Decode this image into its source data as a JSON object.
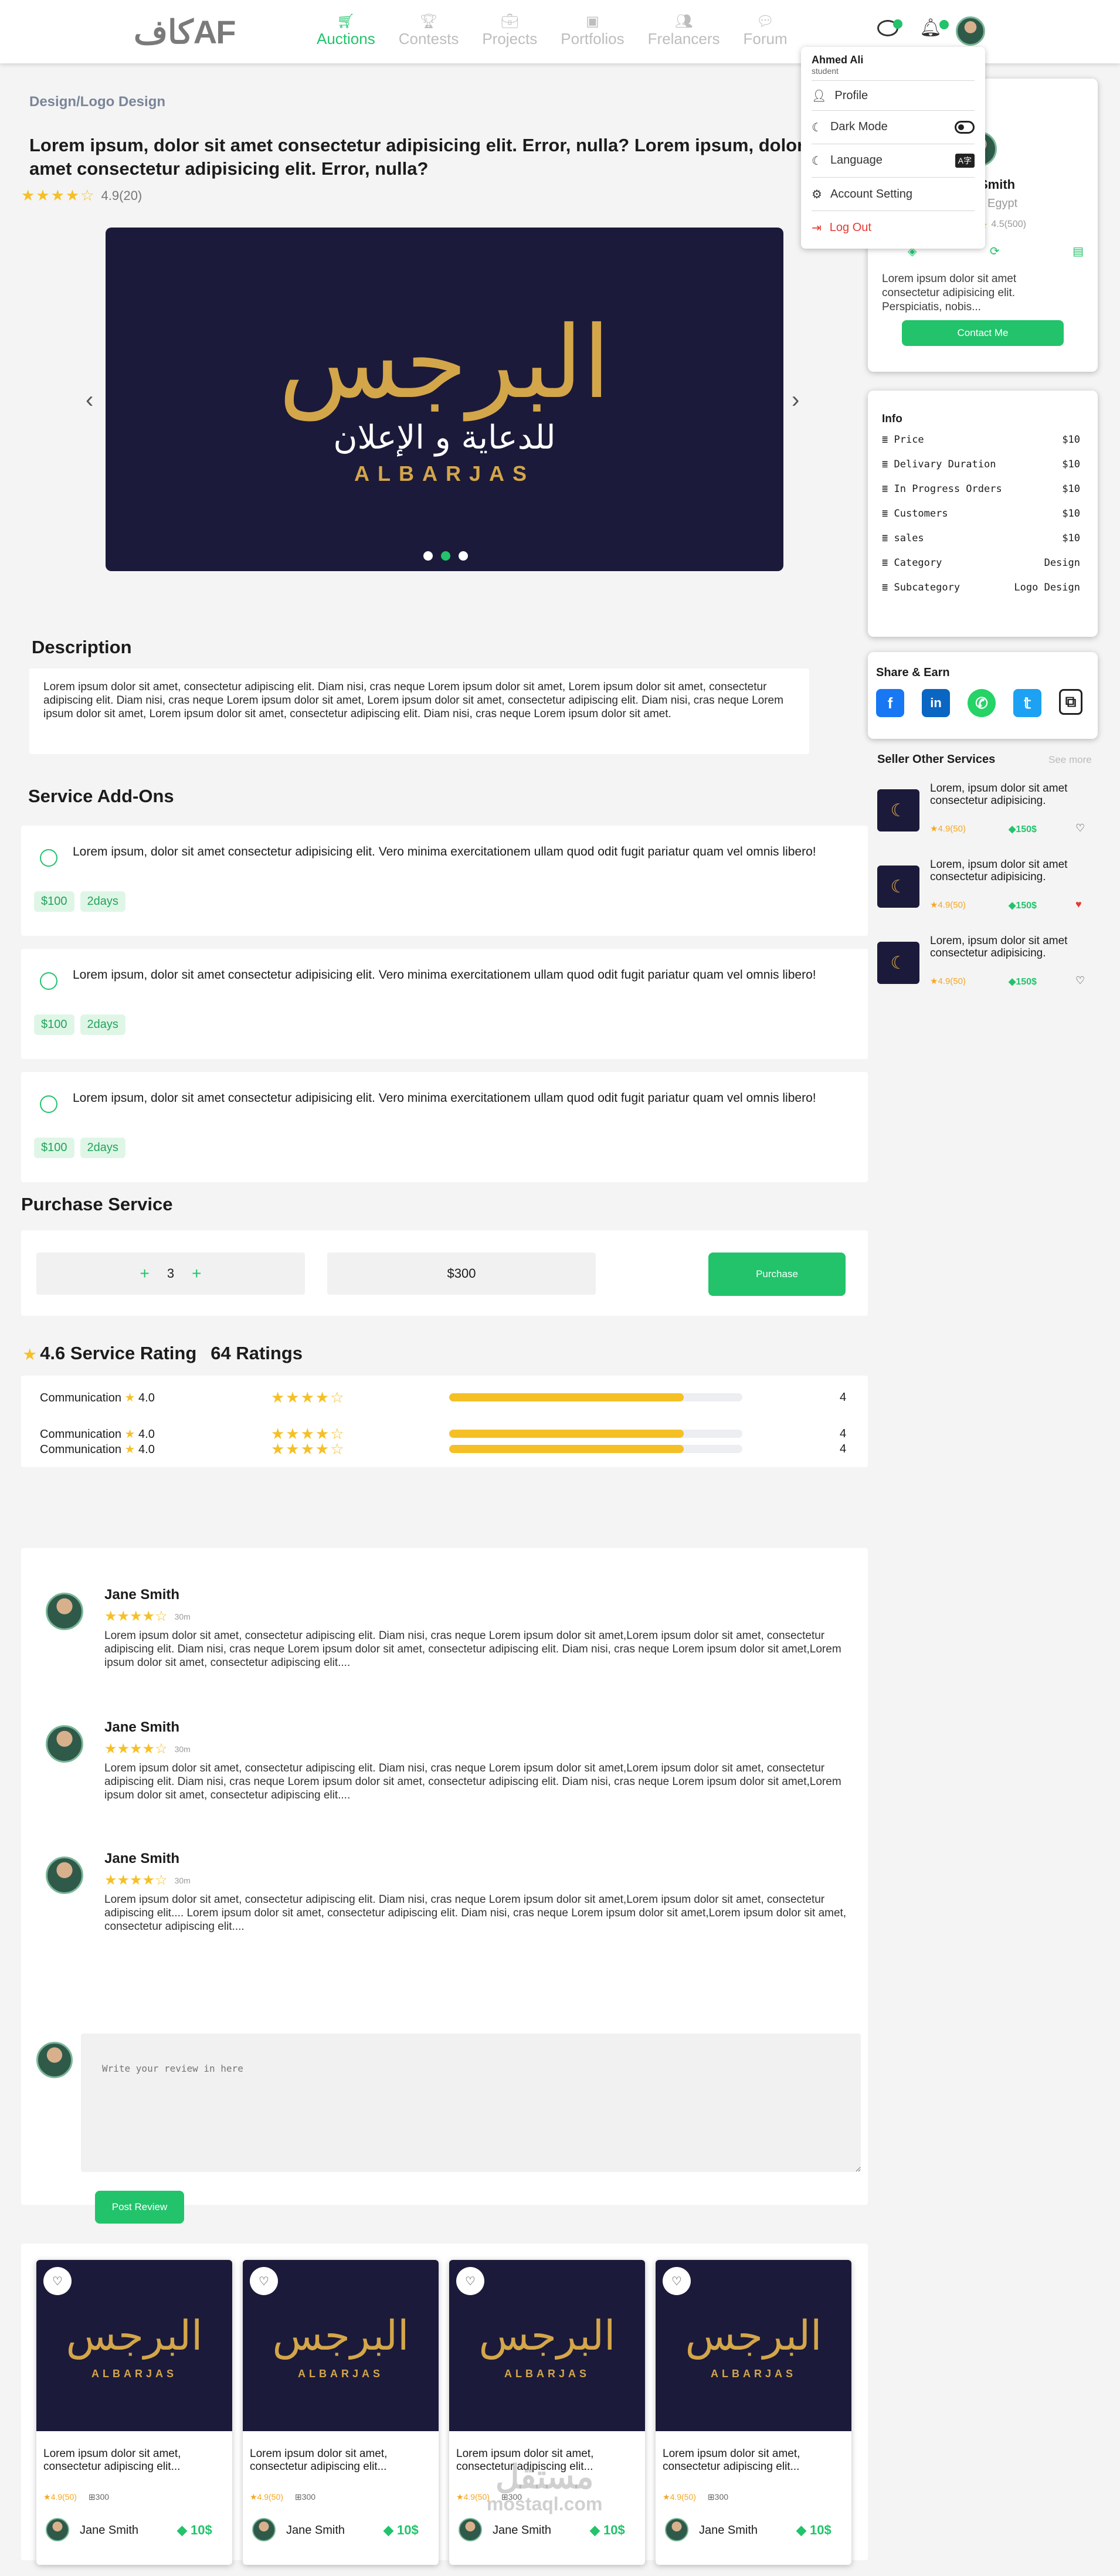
{
  "header": {
    "logo_text": "كافAF",
    "nav": [
      {
        "label": "Auctions",
        "active": true
      },
      {
        "label": "Contests",
        "active": false
      },
      {
        "label": "Projects",
        "active": false
      },
      {
        "label": "Portfolios",
        "active": false
      },
      {
        "label": "Frelancers",
        "active": false
      },
      {
        "label": "Forum",
        "active": false
      }
    ]
  },
  "dropdown": {
    "user_name": "Ahmed Ali",
    "user_role": "student",
    "items": {
      "profile": "Profile",
      "dark_mode": "Dark Mode",
      "language": "Language",
      "account_setting": "Account Setting",
      "logout": "Log Out"
    }
  },
  "breadcrumb": "Design/Logo Design",
  "title": "Lorem ipsum, dolor sit amet consectetur adipisicing elit. Error, nulla? Lorem ipsum, dolor sit amet consectetur adipisicing elit. Error, nulla?",
  "rating_text": "4.9(20)",
  "gallery": {
    "prev": "‹",
    "next": "›",
    "logo_arabic": "البرجس",
    "logo_sub": "للدعاية و الإعلان",
    "logo_latin": "ALBARJAS"
  },
  "seller": {
    "name": "Smith",
    "country": "Egypt",
    "rating": "4.5(500)",
    "bio": "Lorem ipsum dolor sit amet consectetur adipisicing elit. Perspiciatis, nobis...",
    "contact_label": "Contact Me"
  },
  "info": {
    "title": "Info",
    "rows": [
      {
        "label": "Price",
        "value": "$10"
      },
      {
        "label": "Delivary Duration",
        "value": "$10"
      },
      {
        "label": "In Progress Orders",
        "value": "$10"
      },
      {
        "label": "Customers",
        "value": "$10"
      },
      {
        "label": "sales",
        "value": "$10"
      },
      {
        "label": "Category",
        "value": "Design"
      },
      {
        "label": "Subcategory",
        "value": "Logo Design"
      }
    ]
  },
  "share": {
    "title": "Share & Earn"
  },
  "other_services": {
    "title": "Seller Other Services",
    "see_more": "See more",
    "items": [
      {
        "text": "Lorem, ipsum dolor sit amet consectetur adipisicing.",
        "rating": "4.9(50)",
        "price": "150$",
        "liked": false
      },
      {
        "text": "Lorem, ipsum dolor sit amet consectetur adipisicing.",
        "rating": "4.9(50)",
        "price": "150$",
        "liked": true
      },
      {
        "text": "Lorem, ipsum dolor sit amet consectetur adipisicing.",
        "rating": "4.9(50)",
        "price": "150$",
        "liked": false
      }
    ]
  },
  "description": {
    "heading": "Description",
    "text": "Lorem ipsum dolor sit amet, consectetur adipiscing elit. Diam nisi, cras neque Lorem ipsum dolor sit amet, Lorem ipsum dolor sit amet, consectetur adipiscing elit. Diam nisi, cras neque Lorem ipsum dolor sit amet, Lorem ipsum dolor sit amet, consectetur adipiscing elit. Diam nisi, cras neque Lorem ipsum dolor sit amet, Lorem ipsum dolor sit amet, consectetur adipiscing elit. Diam nisi, cras neque Lorem ipsum dolor sit amet."
  },
  "addons": {
    "heading": "Service Add-Ons",
    "items": [
      {
        "text": "Lorem ipsum, dolor sit amet consectetur adipisicing elit. Vero minima exercitationem ullam quod odit fugit pariatur quam vel omnis libero!",
        "price": "$100",
        "duration": "2days"
      },
      {
        "text": "Lorem ipsum, dolor sit amet consectetur adipisicing elit. Vero minima exercitationem ullam quod odit fugit pariatur quam vel omnis libero!",
        "price": "$100",
        "duration": "2days"
      },
      {
        "text": "Lorem ipsum, dolor sit amet consectetur adipisicing elit. Vero minima exercitationem ullam quod odit fugit pariatur quam vel omnis libero!",
        "price": "$100",
        "duration": "2days"
      }
    ]
  },
  "purchase": {
    "heading": "Purchase Service",
    "minus": "+",
    "qty": "3",
    "plus": "+",
    "total": "$300",
    "button": "Purchase"
  },
  "ratings": {
    "score": "4.6 Service Rating",
    "count": "64 Ratings",
    "rows": [
      {
        "label": "Communication",
        "value": "4.0",
        "fill": 0.8,
        "count": "4"
      },
      {
        "label": "Communication",
        "value": "4.0",
        "fill": 0.8,
        "count": "4"
      },
      {
        "label": "Communication",
        "value": "4.0",
        "fill": 0.8,
        "count": "4"
      }
    ]
  },
  "reviews": [
    {
      "name": "Jane Smith",
      "time": "30m",
      "text": "Lorem ipsum dolor sit amet, consectetur adipiscing elit. Diam nisi, cras neque Lorem ipsum dolor sit amet,Lorem ipsum dolor sit amet, consectetur adipiscing elit. Diam nisi, cras neque Lorem ipsum dolor sit amet, consectetur adipiscing elit. Diam nisi, cras neque Lorem ipsum dolor sit amet,Lorem ipsum dolor sit amet, consectetur adipiscing elit...."
    },
    {
      "name": "Jane Smith",
      "time": "30m",
      "text": "Lorem ipsum dolor sit amet, consectetur adipiscing elit. Diam nisi, cras neque Lorem ipsum dolor sit amet,Lorem ipsum dolor sit amet, consectetur adipiscing elit. Diam nisi, cras neque Lorem ipsum dolor sit amet, consectetur adipiscing elit. Diam nisi, cras neque Lorem ipsum dolor sit amet,Lorem ipsum dolor sit amet, consectetur adipiscing elit...."
    },
    {
      "name": "Jane Smith",
      "time": "30m",
      "text": "Lorem ipsum dolor sit amet, consectetur adipiscing elit. Diam nisi, cras neque Lorem ipsum dolor sit amet,Lorem ipsum dolor sit amet, consectetur adipiscing elit.... Lorem ipsum dolor sit amet, consectetur adipiscing elit. Diam nisi, cras neque Lorem ipsum dolor sit amet,Lorem ipsum dolor sit amet, consectetur adipiscing elit...."
    }
  ],
  "review_form": {
    "placeholder": "Write your review in here",
    "button": "Post Review"
  },
  "related": [
    {
      "text": "Lorem ipsum dolor sit amet, consectetur adipiscing elit...",
      "rating": "4.9(50)",
      "orders": "300",
      "seller": "Jane Smith",
      "price": "10$"
    },
    {
      "text": "Lorem ipsum dolor sit amet, consectetur adipiscing elit...",
      "rating": "4.9(50)",
      "orders": "300",
      "seller": "Jane Smith",
      "price": "10$"
    },
    {
      "text": "Lorem ipsum dolor sit amet, consectetur adipiscing elit...",
      "rating": "4.9(50)",
      "orders": "300",
      "seller": "Jane Smith",
      "price": "10$"
    },
    {
      "text": "Lorem ipsum dolor sit amet, consectetur adipiscing elit...",
      "rating": "4.9(50)",
      "orders": "300",
      "seller": "Jane Smith",
      "price": "10$"
    }
  ],
  "watermark": {
    "arabic": "مستقل",
    "latin": "mostaql.com"
  },
  "colors": {
    "accent": "#22c36b",
    "star": "#f5c026",
    "logout": "#e53935",
    "navy": "#1b1a3a"
  }
}
